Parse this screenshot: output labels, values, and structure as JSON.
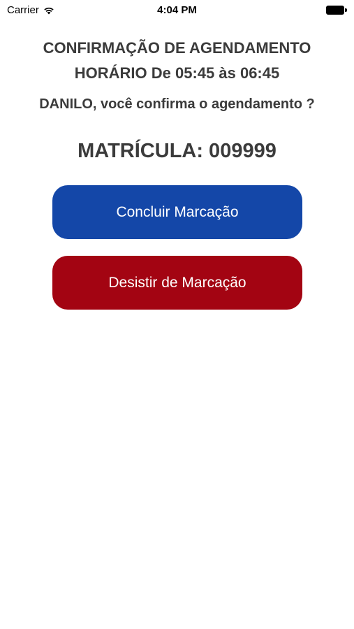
{
  "status_bar": {
    "carrier": "Carrier",
    "time": "4:04 PM",
    "wifi_icon": "wifi-icon",
    "battery_icon": "battery-icon"
  },
  "main": {
    "title": "CONFIRMAÇÃO DE AGENDAMENTO",
    "schedule": "HORÁRIO De 05:45 às 06:45",
    "question": "DANILO, você confirma o agendamento ?",
    "registration": "MATRÍCULA: 009999",
    "confirm_label": "Concluir Marcação",
    "cancel_label": "Desistir de Marcação"
  },
  "colors": {
    "confirm_button": "#1447a8",
    "cancel_button": "#a30412",
    "text": "#3b3b3b",
    "background": "#ffffff"
  }
}
